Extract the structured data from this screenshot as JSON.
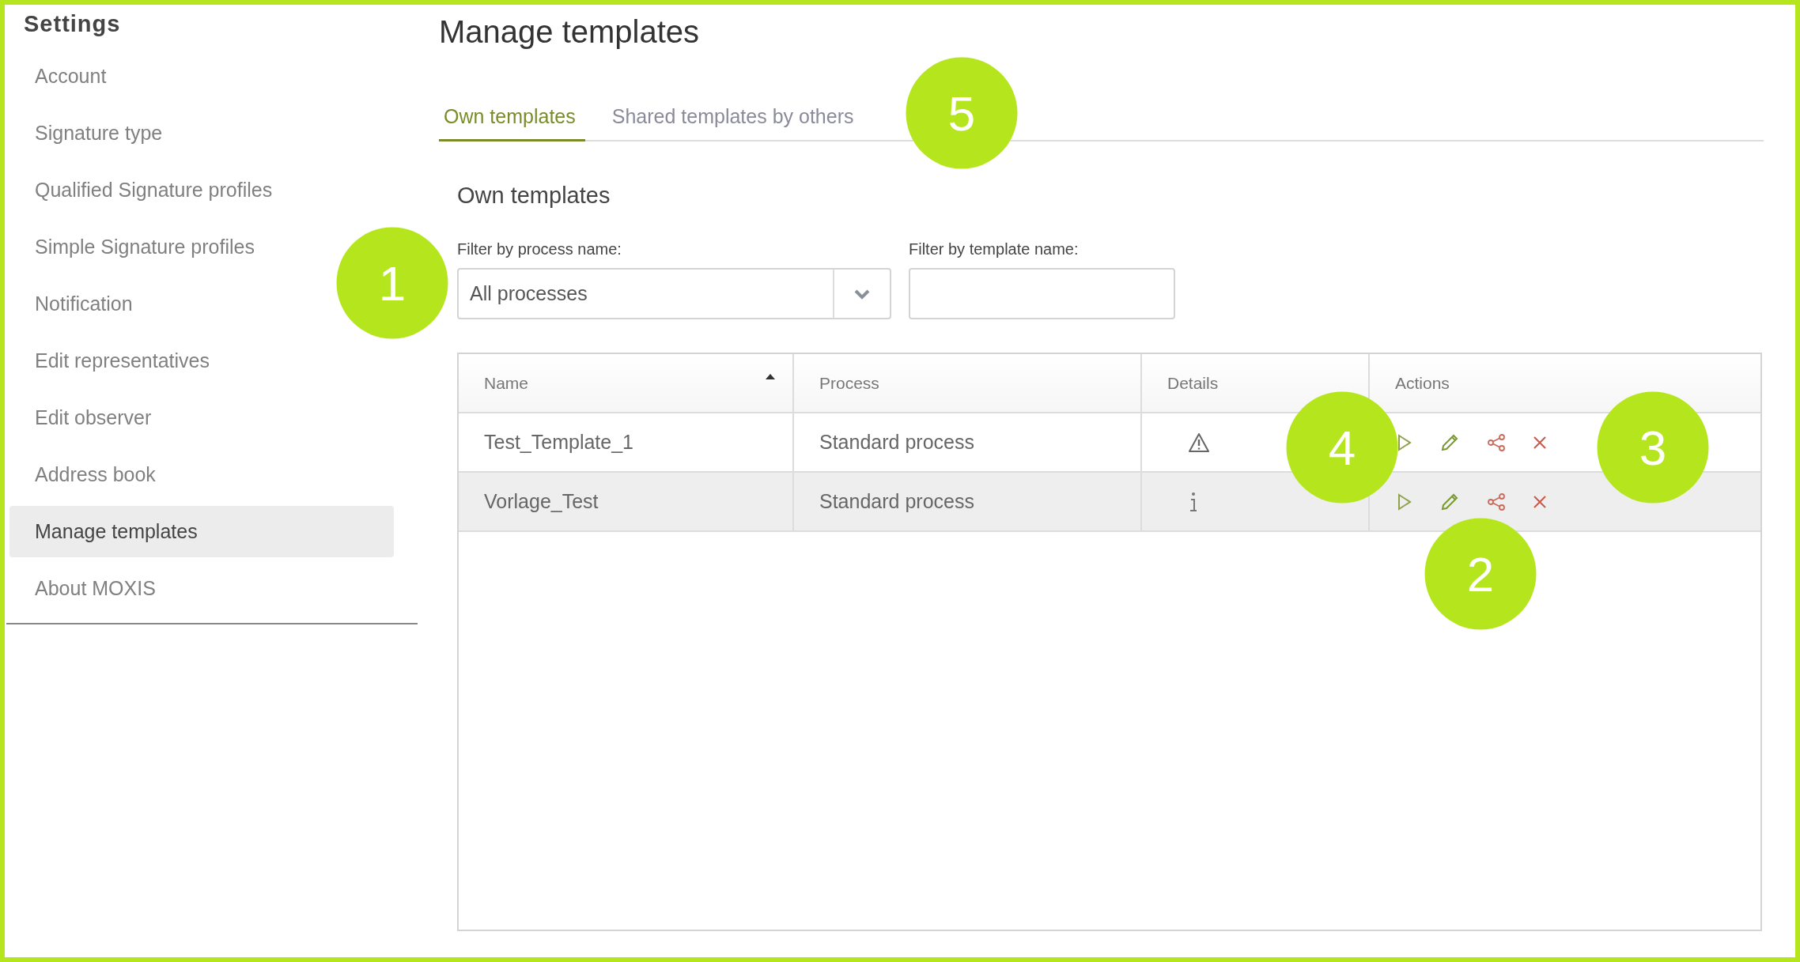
{
  "sidebar": {
    "title": "Settings",
    "items": [
      {
        "label": "Account",
        "selected": false
      },
      {
        "label": "Signature type",
        "selected": false
      },
      {
        "label": "Qualified Signature profiles",
        "selected": false
      },
      {
        "label": "Simple Signature profiles",
        "selected": false
      },
      {
        "label": "Notification",
        "selected": false
      },
      {
        "label": "Edit representatives",
        "selected": false
      },
      {
        "label": "Edit observer",
        "selected": false
      },
      {
        "label": "Address book",
        "selected": false
      },
      {
        "label": "Manage templates",
        "selected": true
      },
      {
        "label": "About MOXIS",
        "selected": false
      }
    ]
  },
  "page_title": "Manage templates",
  "tabs": [
    {
      "label": "Own templates",
      "selected": true
    },
    {
      "label": "Shared templates by others",
      "selected": false
    }
  ],
  "section_title": "Own templates",
  "filters": {
    "process": {
      "label": "Filter by process name:",
      "value": "All processes"
    },
    "template": {
      "label": "Filter by template name:"
    }
  },
  "table": {
    "columns": [
      {
        "label": "Name",
        "sorted": true
      },
      {
        "label": "Process",
        "sorted": false
      },
      {
        "label": "Details",
        "sorted": false
      },
      {
        "label": "Actions",
        "sorted": false
      }
    ],
    "rows": [
      {
        "name": "Test_Template_1",
        "process": "Standard process",
        "details": {
          "kind": "warning"
        },
        "selected": false
      },
      {
        "name": "Vorlage_Test",
        "process": "Standard process",
        "details": {
          "kind": "info"
        },
        "selected": true
      }
    ]
  },
  "callouts": [
    {
      "number": "1"
    },
    {
      "number": "5"
    },
    {
      "number": "4"
    },
    {
      "number": "3"
    },
    {
      "number": "2"
    }
  ]
}
